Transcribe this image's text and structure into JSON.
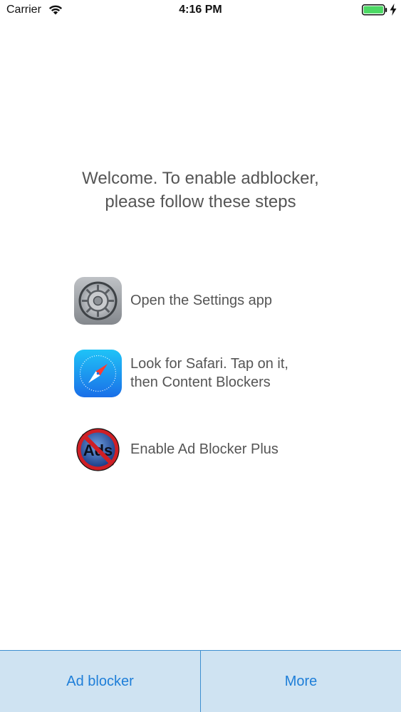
{
  "status_bar": {
    "carrier": "Carrier",
    "time": "4:16 PM",
    "wifi_icon": "wifi-icon",
    "battery_icon": "battery-full-icon",
    "charging_icon": "charging-bolt-icon",
    "battery_color": "#4cd964"
  },
  "welcome_text": "Welcome. To enable adblocker, please follow these steps",
  "steps": [
    {
      "icon": "settings-app-icon",
      "text": "Open the Settings app"
    },
    {
      "icon": "safari-app-icon",
      "text": "Look for Safari. Tap on it,\nthen Content Blockers"
    },
    {
      "icon": "ad-blocker-plus-icon",
      "icon_label": "Ads",
      "text": "Enable Ad Blocker Plus"
    }
  ],
  "tab_bar": {
    "tabs": [
      {
        "label": "Ad blocker"
      },
      {
        "label": "More"
      }
    ],
    "accent_color": "#1e7ed8",
    "background_color": "#cfe3f2"
  }
}
